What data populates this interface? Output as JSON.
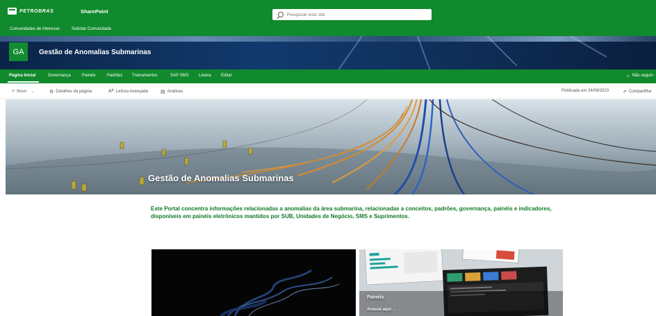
{
  "suite_bar": {
    "brand": "PETROBRAS",
    "app_name": "SharePoint",
    "search_placeholder": "Pesquisar este site"
  },
  "hub_nav": {
    "items": [
      {
        "label": "Comunidades de Interesse"
      },
      {
        "label": "Solicitar Comunidade"
      }
    ]
  },
  "site_header": {
    "logo_initials": "GA",
    "title": "Gestão de Anomalias Submarinas"
  },
  "site_nav": {
    "items": [
      {
        "label": "Página Inicial",
        "active": true
      },
      {
        "label": "Governança"
      },
      {
        "label": "Painéis"
      },
      {
        "label": "Padrões"
      },
      {
        "label": "Treinamentos"
      },
      {
        "label": "SAP SMS"
      },
      {
        "label": "Lixeira"
      },
      {
        "label": "Editar"
      }
    ],
    "follow_label": "Não seguin"
  },
  "command_bar": {
    "new_label": "Novo",
    "page_details_label": "Detalhes da página",
    "immersive_reader_label": "Leitura Avançada",
    "analytics_label": "Análises",
    "published_label": "Publicada em 24/09/2023",
    "share_label": "Compartilha"
  },
  "hero": {
    "title": "Gestão de Anomalias Submarinas"
  },
  "intro": {
    "text": "Este Portal concentra informações relacionadas a anomalias da área submarina, relacionadas a conceitos, padrões, governança, painéis e indicadores, disponíveis em painéis eletrônicos mantidos por SUB, Unidades de Negócio, SMS e Suprimentos."
  },
  "cards": {
    "right_title": "Painéis",
    "right_link": "Acesse aqui →"
  },
  "colors": {
    "brand_green": "#108a2c",
    "intro_text": "#0f7a28",
    "header_navy": "#123a6e"
  }
}
